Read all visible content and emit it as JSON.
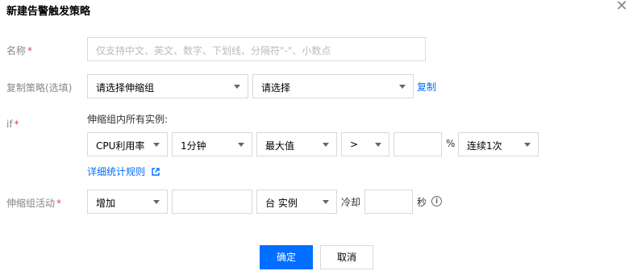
{
  "dialog": {
    "title": "新建告警触发策略"
  },
  "name_field": {
    "label": "名称",
    "required_mark": "*",
    "placeholder": "仅支持中文、英文、数字、下划线、分隔符\"-\"、小数点"
  },
  "copy_policy": {
    "label": "复制策略(选填)",
    "group_select": "请选择伸缩组",
    "policy_select": "请选择",
    "copy_link": "复制"
  },
  "if_section": {
    "label": "if",
    "required_mark": "*",
    "description": "伸缩组内所有实例:",
    "metric": "CPU利用率",
    "period": "1分钟",
    "statistic": "最大值",
    "operator": ">",
    "threshold_value": "",
    "unit": "%",
    "consecutive": "连续1次",
    "detail_link": "详细统计规则"
  },
  "activity": {
    "label": "伸缩组活动",
    "required_mark": "*",
    "action": "增加",
    "count_value": "",
    "count_unit": "台 实例",
    "cooldown_label": "冷却",
    "cooldown_value": "",
    "seconds_label": "秒"
  },
  "footer": {
    "confirm": "确定",
    "cancel": "取消"
  },
  "colors": {
    "primary": "#006eff",
    "required": "#e54545",
    "border": "#d9d9d9"
  },
  "icons": {
    "close": "close-icon",
    "caret": "caret-down-icon",
    "external": "external-link-icon",
    "info": "info-icon"
  }
}
